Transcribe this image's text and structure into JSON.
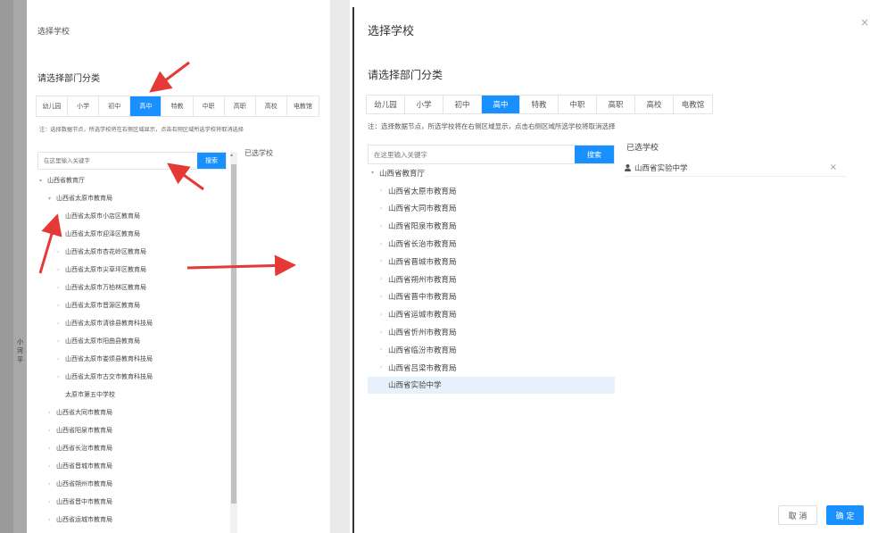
{
  "left": {
    "title": "选择学校",
    "subtitle": "请选择部门分类",
    "tabs": [
      "幼儿园",
      "小学",
      "初中",
      "高中",
      "特教",
      "中职",
      "高职",
      "高校",
      "电教馆"
    ],
    "active_tab_index": 3,
    "note": "注：选择数据节点，所选学校将在右侧区域显示，点击右侧区域所选学校将取消选择",
    "search_placeholder": "在这里输入关键字",
    "search_button": "搜索",
    "selected_header": "已选学校",
    "tree": [
      {
        "label": "山西省教育厅",
        "level": 0,
        "caret": "▾"
      },
      {
        "label": "山西省太原市教育局",
        "level": 1,
        "caret": "▾"
      },
      {
        "label": "山西省太原市小店区教育局",
        "level": 2,
        "caret": "›"
      },
      {
        "label": "山西省太原市迎泽区教育局",
        "level": 2,
        "caret": "›"
      },
      {
        "label": "山西省太原市杏花岭区教育局",
        "level": 2,
        "caret": "›"
      },
      {
        "label": "山西省太原市尖草坪区教育局",
        "level": 2,
        "caret": "›"
      },
      {
        "label": "山西省太原市万柏林区教育局",
        "level": 2,
        "caret": "›"
      },
      {
        "label": "山西省太原市晋源区教育局",
        "level": 2,
        "caret": "›"
      },
      {
        "label": "山西省太原市清徐县教育科技局",
        "level": 2,
        "caret": "›"
      },
      {
        "label": "山西省太原市阳曲县教育局",
        "level": 2,
        "caret": "›"
      },
      {
        "label": "山西省太原市娄烦县教育科技局",
        "level": 2,
        "caret": "›"
      },
      {
        "label": "山西省太原市古交市教育科技局",
        "level": 2,
        "caret": "›"
      },
      {
        "label": "太原市第五中学校",
        "level": 2,
        "caret": ""
      },
      {
        "label": "山西省大同市教育局",
        "level": 1,
        "caret": "›"
      },
      {
        "label": "山西省阳泉市教育局",
        "level": 1,
        "caret": "›"
      },
      {
        "label": "山西省长治市教育局",
        "level": 1,
        "caret": "›"
      },
      {
        "label": "山西省晋城市教育局",
        "level": 1,
        "caret": "›"
      },
      {
        "label": "山西省朔州市教育局",
        "level": 1,
        "caret": "›"
      },
      {
        "label": "山西省晋中市教育局",
        "level": 1,
        "caret": "›"
      },
      {
        "label": "山西省运城市教育局",
        "level": 1,
        "caret": "›"
      }
    ],
    "backdrop_text": [
      "小",
      "河",
      "平"
    ]
  },
  "right": {
    "title": "选择学校",
    "close": "×",
    "subtitle": "请选择部门分类",
    "tabs": [
      "幼儿园",
      "小学",
      "初中",
      "高中",
      "特教",
      "中职",
      "高职",
      "高校",
      "电教馆"
    ],
    "active_tab_index": 3,
    "note": "注：选择数据节点，所选学校将在右侧区域显示，点击右侧区域所选学校将取消选择",
    "search_placeholder": "在这里输入关键字",
    "search_button": "搜索",
    "selected_header": "已选学校",
    "selected_items": [
      {
        "label": "山西省实验中学",
        "remove": "×"
      }
    ],
    "tree": [
      {
        "label": "山西省教育厅",
        "level": 0,
        "caret": "▾"
      },
      {
        "label": "山西省太原市教育局",
        "level": 1,
        "caret": "›"
      },
      {
        "label": "山西省大同市教育局",
        "level": 1,
        "caret": "›"
      },
      {
        "label": "山西省阳泉市教育局",
        "level": 1,
        "caret": "›"
      },
      {
        "label": "山西省长治市教育局",
        "level": 1,
        "caret": "›"
      },
      {
        "label": "山西省晋城市教育局",
        "level": 1,
        "caret": "›"
      },
      {
        "label": "山西省朔州市教育局",
        "level": 1,
        "caret": "›"
      },
      {
        "label": "山西省晋中市教育局",
        "level": 1,
        "caret": "›"
      },
      {
        "label": "山西省运城市教育局",
        "level": 1,
        "caret": "›"
      },
      {
        "label": "山西省忻州市教育局",
        "level": 1,
        "caret": "›"
      },
      {
        "label": "山西省临汾市教育局",
        "level": 1,
        "caret": "›"
      },
      {
        "label": "山西省吕梁市教育局",
        "level": 1,
        "caret": "›"
      },
      {
        "label": "山西省实验中学",
        "level": 1,
        "caret": "",
        "highlighted": true
      }
    ],
    "cancel_button": "取 消",
    "ok_button": "确 定"
  },
  "colors": {
    "primary": "#1890ff",
    "arrow": "#e53935",
    "highlight": "#e6f1fc"
  }
}
